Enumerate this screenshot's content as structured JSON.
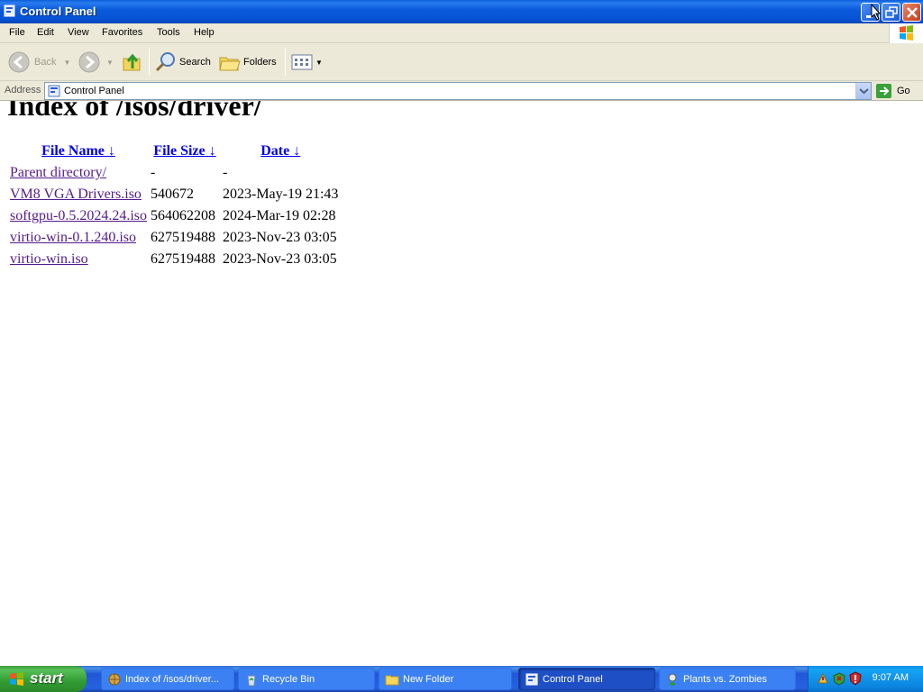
{
  "window": {
    "title": "Control Panel"
  },
  "menu": [
    "File",
    "Edit",
    "View",
    "Favorites",
    "Tools",
    "Help"
  ],
  "toolbar": {
    "back": "Back",
    "search": "Search",
    "folders": "Folders"
  },
  "address": {
    "label": "Address",
    "value": "Control Panel",
    "go": "Go"
  },
  "page": {
    "heading": "Index of /isos/driver/",
    "columns": [
      "File Name",
      "File Size",
      "Date"
    ],
    "sort_glyph": "↓",
    "rows": [
      {
        "name": "Parent directory/",
        "size": "-",
        "date": "-"
      },
      {
        "name": "VM8 VGA Drivers.iso",
        "size": "540672",
        "date": "2023-May-19 21:43"
      },
      {
        "name": "softgpu-0.5.2024.24.iso",
        "size": "564062208",
        "date": "2024-Mar-19 02:28"
      },
      {
        "name": "virtio-win-0.1.240.iso",
        "size": "627519488",
        "date": "2023-Nov-23 03:05"
      },
      {
        "name": "virtio-win.iso",
        "size": "627519488",
        "date": "2023-Nov-23 03:05"
      }
    ]
  },
  "taskbar": {
    "start": "start",
    "tasks": [
      {
        "label": "Index of /isos/driver...",
        "icon": "browser-icon"
      },
      {
        "label": "Recycle Bin",
        "icon": "recycle-bin-icon"
      },
      {
        "label": "New Folder",
        "icon": "folder-icon"
      },
      {
        "label": "Control Panel",
        "icon": "control-panel-icon"
      },
      {
        "label": "Plants vs. Zombies",
        "icon": "game-icon"
      }
    ],
    "clock": "9:07 AM"
  }
}
